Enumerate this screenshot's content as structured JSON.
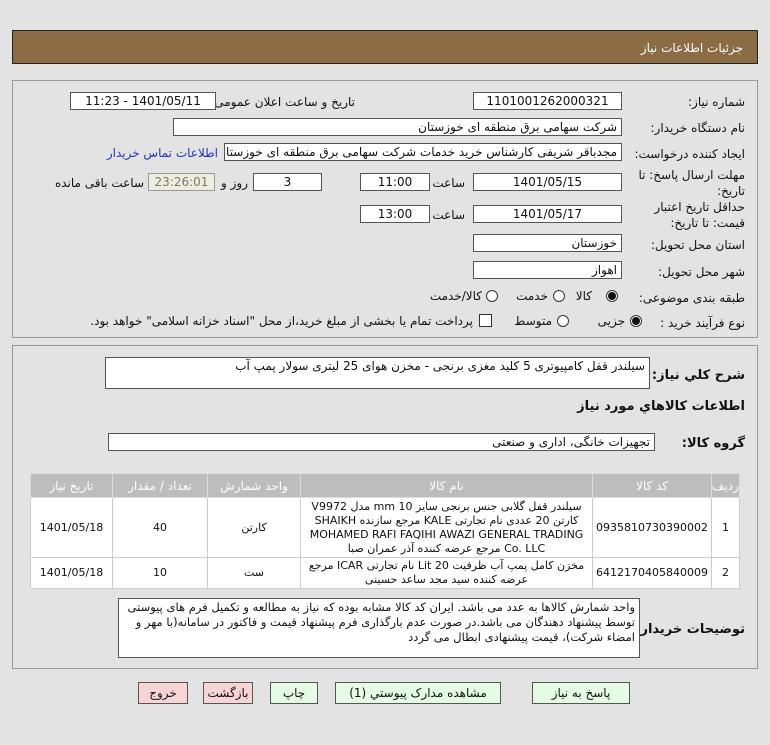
{
  "header": {
    "title": "جزئیات اطلاعات نیاز"
  },
  "form": {
    "need_number_label": "شماره نیاز:",
    "need_number": "1101001262000321",
    "announce_label": "تاریخ و ساعت اعلان عمومی:",
    "announce_value": "1401/05/11 - 11:23",
    "buyer_label": "نام دستگاه خریدار:",
    "buyer": "شرکت سهامی برق منطقه ای خوزستان",
    "creator_label": "ایجاد کننده درخواست:",
    "creator": "مجدباقر شریفی کارشناس خرید خدمات شرکت سهامی برق منطقه ای خوزستان",
    "contact_link": "اطلاعات تماس خریدار",
    "deadline_label_1": "مهلت ارسال پاسخ: تا",
    "deadline_label_2": "تاریخ:",
    "deadline_date": "1401/05/15",
    "time_label": "ساعت",
    "deadline_time": "11:00",
    "days": "3",
    "days_label": "روز و",
    "remaining": "23:26:01",
    "remaining_label": "ساعت باقی مانده",
    "validity_label_1": "حداقل تاریخ اعتبار",
    "validity_label_2": "قیمت: تا تاریخ:",
    "validity_date": "1401/05/17",
    "validity_time": "13:00",
    "province_label": "استان محل تحویل:",
    "province": "خوزستان",
    "city_label": "شهر محل تحویل:",
    "city": "اهواز",
    "category_label": "طبقه بندی موضوعی:",
    "category_options": [
      "کالا",
      "خدمت",
      "کالا/خدمت"
    ],
    "category_selected": "کالا",
    "process_label": "نوع فرآیند خرید :",
    "process_options": [
      "جزیی",
      "متوسط"
    ],
    "process_selected": "جزیی",
    "payment_note": "پرداخت تمام یا بخشی از مبلغ خرید،از محل \"اسناد خزانه اسلامی\" خواهد بود."
  },
  "details": {
    "summary_label": "شرح کلي نياز:",
    "summary": "سیلندر قفل کامپیوتری 5 کلید مغزی برنجی - مخزن هوای 25 لیتری سولار پمپ آب",
    "goods_title": "اطلاعات کالاهاي مورد نياز",
    "group_label": "گروه کالا:",
    "group": "تجهیزات خانگی، اداری و صنعتی",
    "table": {
      "headers": [
        "ردیف",
        "کد کالا",
        "نام کالا",
        "واحد شمارش",
        "تعداد / مقدار",
        "تاریخ نیاز"
      ],
      "rows": [
        [
          "1",
          "0935810730390002",
          "سیلندر قفل گلابی جنس برنجی سایز 10 mm مدل V9972 کارتن 20 عددی نام تجارتی KALE مرجع سازنده SHAIKH MOHAMED RAFI FAQIHI AWAZI GENERAL TRADING Co. LLC مرجع عرضه کننده آذر عمران صبا",
          "کارتن",
          "40",
          "1401/05/18"
        ],
        [
          "2",
          "6412170405840009",
          "مخزن کامل پمپ آب ظرفیت 20 Lit نام تجارتی ICAR مرجع عرضه کننده سید مجد ساعد حسینی",
          "ست",
          "10",
          "1401/05/18"
        ]
      ]
    },
    "notes_label": "توضیحات خریدار:",
    "notes": "واحد شمارش کالاها به عدد می باشد. ایران کد کالا مشابه بوده که نیاز به مطالعه و تکمیل فرم های پیوستی توسط پیشنهاد دهندگان می باشد.در صورت عدم بارگذاری فرم پیشنهاد قیمت و فاکتور در سامانه(با مهر و امضاء شرکت)، قیمت پیشنهادی ابطال می گردد"
  },
  "buttons": {
    "reply": "پاسخ به نیاز",
    "attachments": "مشاهده مدارک پیوستي (1)",
    "print": "چاپ",
    "back": "بازگشت",
    "exit": "خروج"
  },
  "colors": {
    "header": "#8c6c44",
    "timer_bg": "#eeeedd",
    "green_button": "#e4fbe4",
    "red_button": "#f8d4d4",
    "link": "#2233bb"
  }
}
